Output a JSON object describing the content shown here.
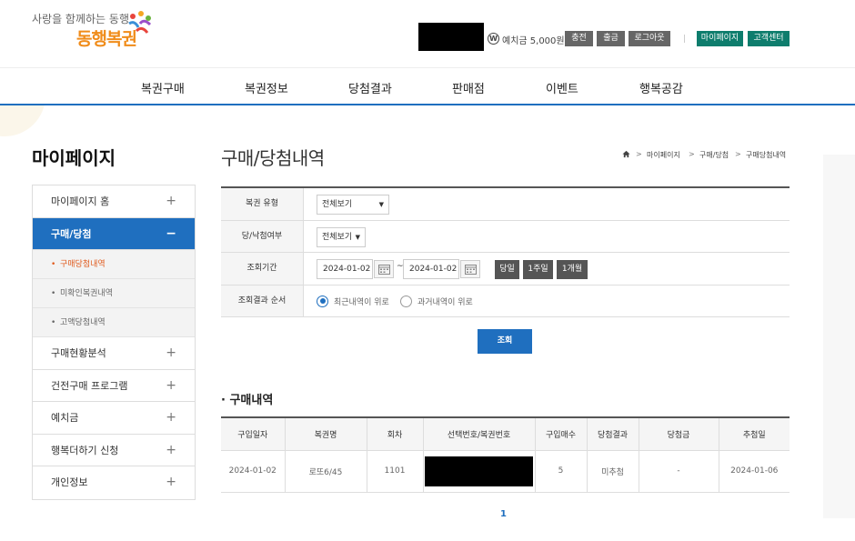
{
  "header": {
    "slogan": "사랑을 함께하는 동행",
    "brand": "동행복권",
    "deposit_icon": "W",
    "deposit_text": "예치금 5,000원",
    "buttons": [
      "충전",
      "출금",
      "로그아웃"
    ],
    "green_buttons": [
      "마이페이지",
      "고객센터"
    ]
  },
  "gnb": [
    "복권구매",
    "복권정보",
    "당첨결과",
    "판매점",
    "이벤트",
    "행복공감"
  ],
  "sidebar": {
    "title": "마이페이지",
    "items": [
      {
        "label": "마이페이지 홈",
        "sign": "+"
      },
      {
        "label": "구매/당첨",
        "sign": "−"
      }
    ],
    "sub_items": [
      "구매당첨내역",
      "미확인복권내역",
      "고액당첨내역"
    ],
    "more_items": [
      {
        "label": "구매현황분석",
        "sign": "+"
      },
      {
        "label": "건전구매 프로그램",
        "sign": "+"
      },
      {
        "label": "예치금",
        "sign": "+"
      },
      {
        "label": "행복더하기 신청",
        "sign": "+"
      },
      {
        "label": "개인정보",
        "sign": "+"
      }
    ]
  },
  "main": {
    "title": "구매/당첨내역",
    "breadcrumb": [
      "마이페이지",
      "구매/당첨",
      "구매당첨내역"
    ],
    "search": {
      "type_label": "복권 유형",
      "type_value": "전체보기",
      "win_label": "당/낙첨여부",
      "win_value": "전체보기",
      "period_label": "조회기간",
      "date_from": "2024-01-02",
      "date_to": "2024-01-02",
      "tilde": "~",
      "period_buttons": [
        "당일",
        "1주일",
        "1개월"
      ],
      "order_label": "조회결과 순서",
      "order_options": [
        "최근내역이 위로",
        "과거내역이 위로"
      ],
      "order_selected": 0
    },
    "query_button": "조회",
    "section_title": "· 구매내역",
    "table": {
      "headers": [
        "구입일자",
        "복권명",
        "회차",
        "선택번호/복권번호",
        "구입매수",
        "당첨결과",
        "당첨금",
        "추첨일"
      ],
      "rows": [
        [
          "2024-01-02",
          "로또6/45",
          "1101",
          "",
          "5",
          "미추첨",
          "-",
          "2024-01-06"
        ]
      ]
    },
    "pagination": "1"
  }
}
